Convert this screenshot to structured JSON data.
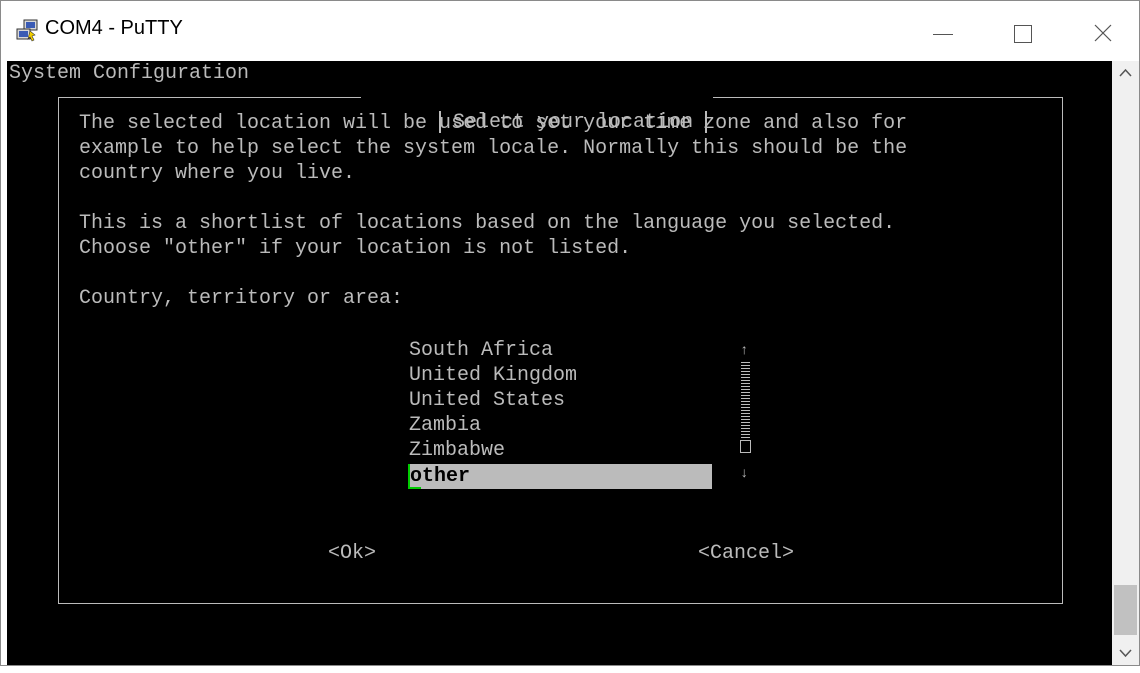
{
  "window": {
    "title": "COM4 - PuTTY",
    "controls": {
      "minimize": "—",
      "maximize": "☐",
      "close": "✕"
    }
  },
  "terminal": {
    "header": "System Configuration",
    "dialog_title": "Select your location",
    "paragraph1": [
      "The selected location will be used to set your time zone and also for",
      "example to help select the system locale. Normally this should be the",
      "country where you live."
    ],
    "paragraph2": [
      "This is a shortlist of locations based on the language you selected.",
      "Choose \"other\" if your location is not listed."
    ],
    "prompt": "Country, territory or area:",
    "options": [
      "South Africa",
      "United Kingdom",
      "United States",
      "Zambia",
      "Zimbabwe"
    ],
    "selected_option": "other",
    "buttons": {
      "ok": "<Ok>",
      "cancel": "<Cancel>"
    },
    "scroll_arrows": {
      "up": "↑",
      "down": "↓"
    }
  },
  "colors": {
    "terminal_bg": "#000000",
    "terminal_fg": "#bbbbbb",
    "cursor": "#00cc00",
    "selection_bg": "#bbbbbb"
  }
}
